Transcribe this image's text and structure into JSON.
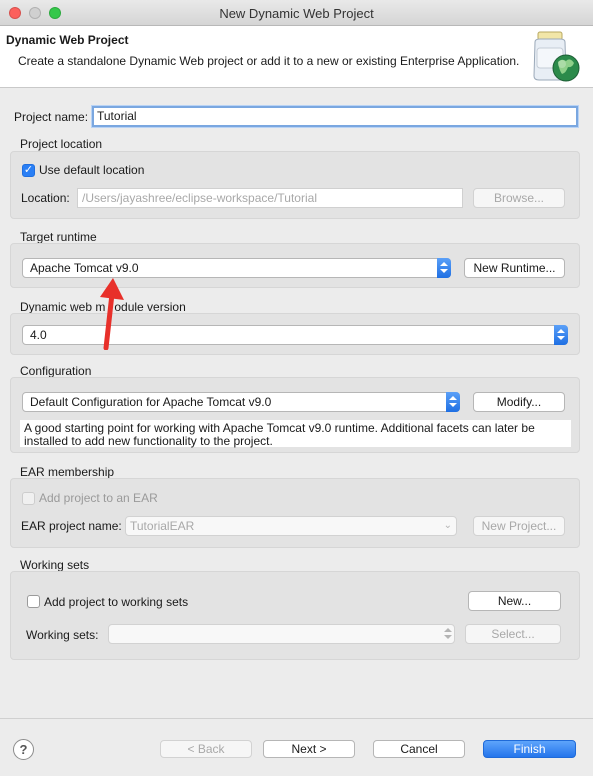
{
  "window": {
    "title": "New Dynamic Web Project"
  },
  "banner": {
    "title": "Dynamic Web Project",
    "description": "Create a standalone Dynamic Web project or add it to a new or existing Enterprise Application."
  },
  "project_name": {
    "label": "Project name:",
    "value": "Tutorial"
  },
  "project_location": {
    "section": "Project location",
    "use_default_label": "Use default location",
    "use_default_checked": true,
    "location_label": "Location:",
    "location_value": "/Users/jayashree/eclipse-workspace/Tutorial",
    "browse_label": "Browse..."
  },
  "target_runtime": {
    "section": "Target runtime",
    "selected": "Apache Tomcat v9.0",
    "new_runtime_label": "New Runtime..."
  },
  "web_module": {
    "section_part1": "Dynamic web m",
    "section_part2": "odule version",
    "selected": "4.0"
  },
  "configuration": {
    "section": "Configuration",
    "selected": "Default Configuration for Apache Tomcat v9.0",
    "modify_label": "Modify...",
    "description": "A good starting point for working with Apache Tomcat v9.0 runtime. Additional facets can later be installed to add new functionality to the project."
  },
  "ear": {
    "section": "EAR membership",
    "add_label": "Add project to an EAR",
    "name_label": "EAR project name:",
    "name_value": "TutorialEAR",
    "new_project_label": "New Project..."
  },
  "working_sets": {
    "section": "Working sets",
    "add_label": "Add project to working sets",
    "new_label": "New...",
    "sets_label": "Working sets:",
    "sets_value": "",
    "select_label": "Select..."
  },
  "footer": {
    "help_glyph": "?",
    "back_label": "< Back",
    "next_label": "Next >",
    "cancel_label": "Cancel",
    "finish_label": "Finish"
  },
  "annotation": {
    "arrow_color": "#e8302a"
  },
  "colors": {
    "accent": "#2475ec",
    "focus_ring": "#7aa7e0"
  }
}
